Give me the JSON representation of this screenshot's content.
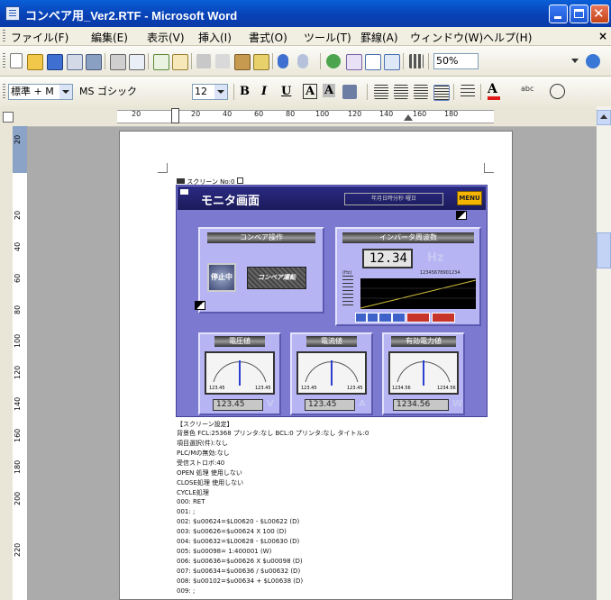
{
  "window": {
    "title": "コンベア用_Ver2.RTF - Microsoft Word"
  },
  "menu": [
    "ファイル(F)",
    "編集(E)",
    "表示(V)",
    "挿入(I)",
    "書式(O)",
    "ツール(T)",
    "罫線(A)",
    "ウィンドウ(W)",
    "ヘルプ(H)"
  ],
  "toolbar": {
    "zoom": "50%"
  },
  "format": {
    "style": "標準 + M",
    "font": "MS ゴシック",
    "size": "12",
    "bold": "B",
    "italic": "I",
    "underline": "U",
    "char_border": "A",
    "char_shade": "A"
  },
  "ruler": {
    "h_ticks": [
      "20",
      "20",
      "40",
      "60",
      "80",
      "100",
      "120",
      "140",
      "160",
      "180"
    ],
    "v_ticks": [
      "20",
      "20",
      "40",
      "60",
      "80",
      "100",
      "120",
      "140",
      "160",
      "180",
      "200",
      "220"
    ]
  },
  "doc": {
    "caption": "スクリーン No:0",
    "screen": {
      "title": "モニタ画面",
      "header_box": "年月日時分秒 曜日",
      "menu_btn": "MENU",
      "conveyor_title": "コンベア操作",
      "stop_btn": "停止中",
      "run_btn": "コンベア運転",
      "inverter_title": "インバータ周波数",
      "inverter_value": "12.34",
      "inverter_unit": "Hz",
      "trend_ylabel": "(Hz)",
      "trend_header": "12345678901234",
      "meters": [
        {
          "title": "電圧値",
          "lo": "123.45",
          "hi": "123.45",
          "value": "123.45",
          "unit": "V"
        },
        {
          "title": "電流値",
          "lo": "123.45",
          "hi": "123.45",
          "value": "123.45",
          "unit": "A"
        },
        {
          "title": "有効電力値",
          "lo": "1234.56",
          "hi": "1234.56",
          "value": "1234.56",
          "unit": "W"
        }
      ]
    },
    "lines": [
      "【スクリーン設定】",
      "背景色 FCL:25368 プリンタ:なし BCL:0 プリンタ:なし タイトル:0",
      "項目選択(件):なし",
      "PLC/Mの無効:なし",
      "受信ストロボ:40",
      "OPEN 処理 使用しない",
      "CLOSE処理 使用しない",
      "CYCLE処理",
      "000:      RET",
      "001: ;",
      "002:      $u00624=$L00620 - $L00622 (D)",
      "003:      $u00626=$u00624 X 100 (D)",
      "004:      $u00632=$L00628 - $L00630 (D)",
      "005:      $u00098= 1:400001 (W)",
      "006:      $u00636=$u00626 X $u00098 (D)",
      "007:      $u00634=$u00636 / $u00632 (D)",
      "008:      $u00102=$u00634 + $L00638 (D)",
      "009: ;"
    ]
  },
  "colors": {
    "titlebar": "#0842b7",
    "screen_bg": "#7c7ad0",
    "screen_header": "#1b1a5a",
    "menu_btn": "#f4b400"
  },
  "icons": [
    "word-app-icon",
    "minimize-icon",
    "maximize-icon",
    "close-icon",
    "new-icon",
    "open-icon",
    "save-icon",
    "print-icon",
    "print-preview-icon",
    "spelling-icon",
    "cut-icon",
    "copy-icon",
    "paste-icon",
    "format-painter-icon",
    "undo-icon",
    "redo-icon",
    "hyperlink-icon",
    "table-icon",
    "columns-icon",
    "help-icon",
    "align-left-icon",
    "center-icon",
    "align-right-icon",
    "justify-icon",
    "bullets-icon",
    "font-color-icon"
  ]
}
